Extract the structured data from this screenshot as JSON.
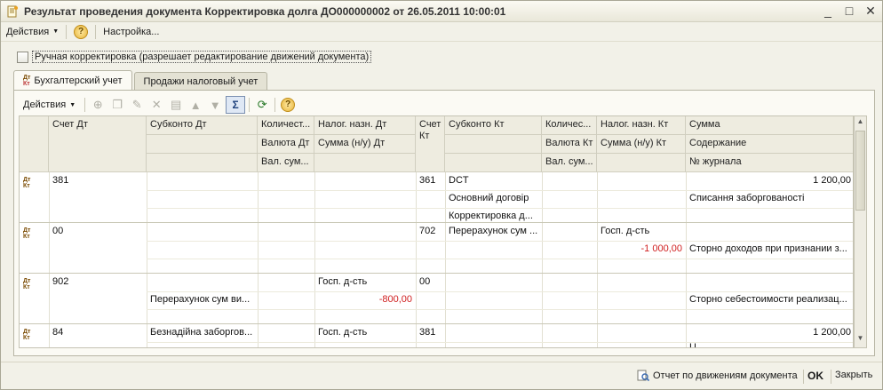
{
  "window": {
    "title": "Результат проведения документа Корректировка долга ДО000000002 от 26.05.2011 10:00:01",
    "controls": [
      "_",
      "□",
      "✕"
    ]
  },
  "menubar": {
    "actions": "Действия",
    "settings": "Настройка..."
  },
  "manual_correction": {
    "label": "Ручная корректировка (разрешает редактирование движений документа)",
    "checked": false
  },
  "tabs": [
    {
      "label": "Бухгалтерский учет",
      "active": true
    },
    {
      "label": "Продажи налоговый учет",
      "active": false
    }
  ],
  "toolbar": {
    "actions": "Действия",
    "icons": [
      "add-icon",
      "copy-icon",
      "edit-icon",
      "delete-icon",
      "save-icon",
      "move-up-icon",
      "move-down-icon",
      "sigma-icon",
      "refresh-icon",
      "help-icon"
    ]
  },
  "dtkt_icon": {
    "top": "Дт",
    "bottom": "Кт"
  },
  "table": {
    "headers": {
      "r1": [
        "Счет Дт",
        "Субконто Дт",
        "Количест...",
        "Налог. назн. Дт",
        "Счет Кт",
        "Субконто Кт",
        "Количес...",
        "Налог. назн. Кт",
        "Сумма"
      ],
      "r2": [
        "Валюта Дт",
        "Сумма (н/у) Дт",
        "Валюта Кт",
        "Сумма (н/у) Кт",
        "Содержание"
      ],
      "r3": [
        "Вал. сум...",
        "Вал. сум...",
        "№ журнала"
      ]
    },
    "rows": [
      {
        "acc_dt": "381",
        "sub_dt": [
          "",
          "",
          ""
        ],
        "nal_dt": "",
        "sum_nu_dt": "",
        "acc_kt": "361",
        "sub_kt": [
          "DCT",
          "Основний договір",
          "Корректировка д..."
        ],
        "nal_kt": "",
        "sum_nu_kt": "",
        "sum": "1 200,00",
        "content": "Списання заборгованості"
      },
      {
        "acc_dt": "00",
        "sub_dt": [
          "",
          "",
          ""
        ],
        "nal_dt": "",
        "sum_nu_dt": "",
        "acc_kt": "702",
        "sub_kt": [
          "Перерахунок сум ...",
          "",
          ""
        ],
        "nal_kt": "Госп. д-сть",
        "sum_nu_kt": "-1 000,00",
        "sum": "",
        "content": "Сторно доходов при признании з..."
      },
      {
        "acc_dt": "902",
        "sub_dt": [
          "",
          "Перерахунок сум ви...",
          ""
        ],
        "nal_dt": "Госп. д-сть",
        "sum_nu_dt": "-800,00",
        "acc_kt": "00",
        "sub_kt": [
          "",
          "",
          ""
        ],
        "nal_kt": "",
        "sum_nu_kt": "",
        "sum": "",
        "content": "Сторно себестоимости реализац..."
      },
      {
        "acc_dt": "84",
        "sub_dt": [
          "Безнадійна заборгов...",
          "",
          ""
        ],
        "nal_dt": "Госп. д-сть",
        "sum_nu_dt": "",
        "acc_kt": "381",
        "sub_kt": [
          "",
          "",
          ""
        ],
        "nal_kt": "",
        "sum_nu_kt": "",
        "sum": "1 200,00",
        "content": "Ц"
      }
    ]
  },
  "footer": {
    "report": "Отчет по движениям документа",
    "ok": "OK",
    "close": "Закрыть"
  }
}
